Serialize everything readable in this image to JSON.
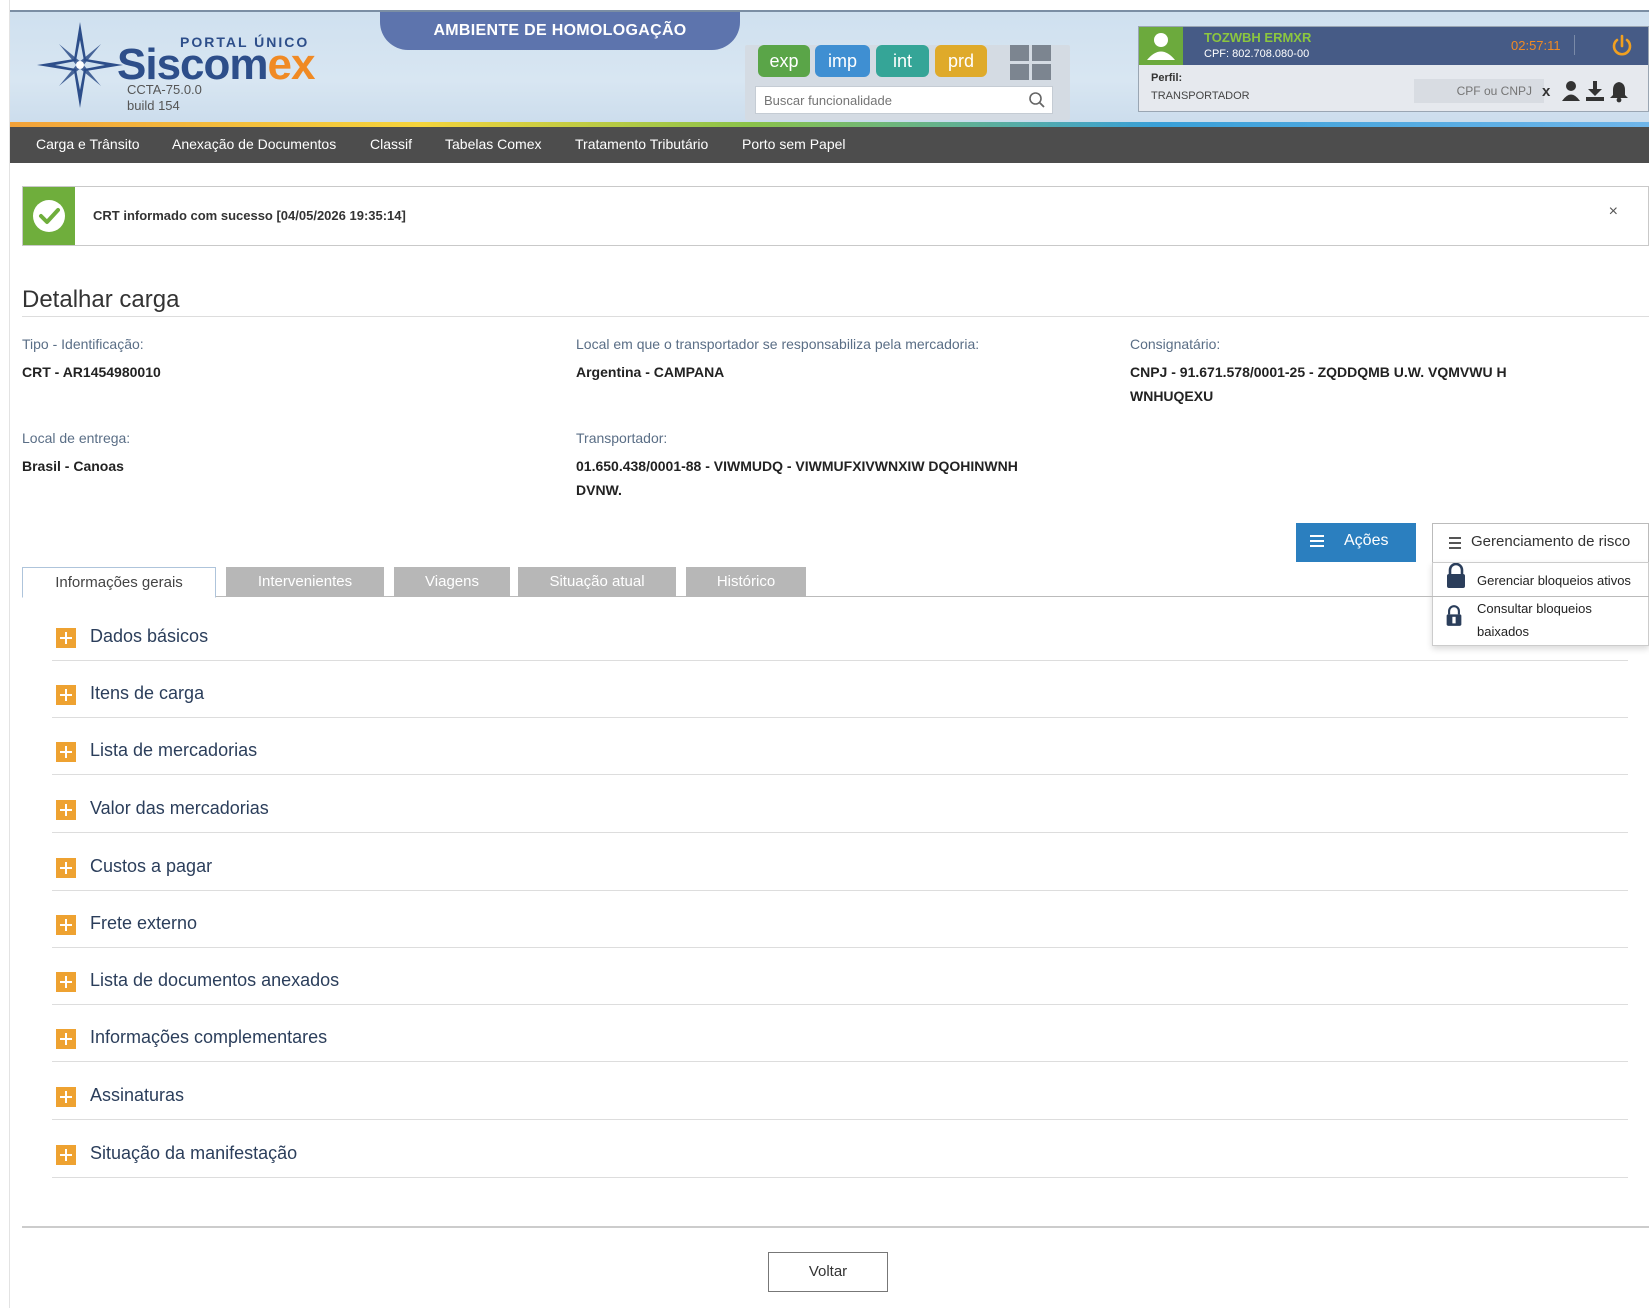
{
  "header": {
    "portal_label": "PORTAL ÚNICO",
    "brand_main": "Siscom",
    "brand_accent": "ex",
    "version": "CCTA-75.0.0",
    "build": "build 154",
    "environment_banner": "AMBIENTE DE HOMOLOGAÇÃO",
    "env_buttons": [
      "exp",
      "imp",
      "int",
      "prd"
    ],
    "search_placeholder": "Buscar funcionalidade"
  },
  "user": {
    "name": "TOZWBH ERMXR",
    "cpf": "CPF: 802.708.080-00",
    "timer": "02:57:11",
    "perfil_label": "Perfil:",
    "perfil_value": "TRANSPORTADOR",
    "cpf_cnpj_placeholder": "CPF ou CNPJ",
    "clear_label": "x"
  },
  "menu": [
    "Carga e Trânsito",
    "Anexação de Documentos",
    "Classif",
    "Tabelas Comex",
    "Tratamento Tributário",
    "Porto sem Papel"
  ],
  "alert": {
    "message": "CRT informado com sucesso [04/05/2026 19:35:14]",
    "close": "×"
  },
  "page_title": "Detalhar carga",
  "fields": {
    "tipo_label": "Tipo - Identificação:",
    "tipo_value": "CRT - AR1454980010",
    "local_resp_label": "Local em que o transportador se responsabiliza pela mercadoria:",
    "local_resp_value": "Argentina - CAMPANA",
    "consignatario_label": "Consignatário:",
    "consignatario_value_1": "CNPJ - 91.671.578/0001-25 - ZQDDQMB U.W. VQMVWU H",
    "consignatario_value_2": "WNHUQEXU",
    "local_entrega_label": "Local de entrega:",
    "local_entrega_value": "Brasil - Canoas",
    "transportador_label": "Transportador:",
    "transportador_value_1": "01.650.438/0001-88 - VIWMUDQ - VIWMUFXIVWNXIW DQOHINWNH",
    "transportador_value_2": "DVNW."
  },
  "actions": {
    "acoes": "Ações",
    "risco": "Gerenciamento de risco",
    "risk_menu": {
      "item1": "Gerenciar bloqueios ativos",
      "item2_line1": "Consultar bloqueios",
      "item2_line2": "baixados"
    }
  },
  "tabs": [
    "Informações gerais",
    "Intervenientes",
    "Viagens",
    "Situação atual",
    "Histórico"
  ],
  "sections": [
    "Dados básicos",
    "Itens de carga",
    "Lista de mercadorias",
    "Valor das mercadorias",
    "Custos a pagar",
    "Frete externo",
    "Lista de documentos anexados",
    "Informações complementares",
    "Assinaturas",
    "Situação da manifestação"
  ],
  "voltar": "Voltar",
  "colors": {
    "menu_bg": "#4d4d4d",
    "accent_blue": "#2b7fbf",
    "success_green": "#6fae3c",
    "section_plus": "#eea231",
    "brand_orange": "#f08a24",
    "brand_navy": "#2d4e8a"
  }
}
